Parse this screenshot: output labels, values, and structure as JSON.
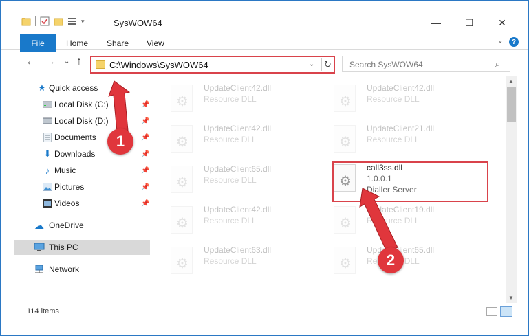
{
  "window": {
    "title": "SysWOW64",
    "controls": {
      "minimize": "—",
      "maximize": "☐",
      "close": "✕"
    }
  },
  "ribbon": {
    "file": "File",
    "tabs": [
      "Home",
      "Share",
      "View"
    ],
    "help": "?"
  },
  "address": {
    "path": "C:\\Windows\\SysWOW64",
    "search_placeholder": "Search SysWOW64"
  },
  "nav": {
    "quick_access": "Quick access",
    "items": [
      {
        "label": "Local Disk (C:)",
        "icon": "drive-icon",
        "pinned": true
      },
      {
        "label": "Local Disk (D:)",
        "icon": "drive-icon",
        "pinned": true
      },
      {
        "label": "Documents",
        "icon": "documents-icon",
        "pinned": true
      },
      {
        "label": "Downloads",
        "icon": "downloads-icon",
        "pinned": true
      },
      {
        "label": "Music",
        "icon": "music-icon",
        "pinned": true
      },
      {
        "label": "Pictures",
        "icon": "pictures-icon",
        "pinned": true
      },
      {
        "label": "Videos",
        "icon": "videos-icon",
        "pinned": true
      }
    ],
    "onedrive": "OneDrive",
    "this_pc": "This PC",
    "network": "Network"
  },
  "files": [
    {
      "name": "UpdateClient42.dll",
      "type": "Resource DLL"
    },
    {
      "name": "UpdateClient42.dll",
      "type": "Resource DLL"
    },
    {
      "name": "UpdateClient42.dll",
      "type": "Resource DLL"
    },
    {
      "name": "UpdateClient21.dll",
      "type": "Resource DLL"
    },
    {
      "name": "UpdateClient65.dll",
      "type": "Resource DLL"
    },
    {
      "name": "call3ss.dll",
      "version": "1.0.0.1",
      "description": "Dialler Server"
    },
    {
      "name": "UpdateClient42.dll",
      "type": "Resource DLL"
    },
    {
      "name": "UpdateClient19.dll",
      "type": "Resource DLL"
    },
    {
      "name": "UpdateClient63.dll",
      "type": "Resource DLL"
    },
    {
      "name": "UpdateClient65.dll",
      "type": "Resource DLL"
    }
  ],
  "status": {
    "count": "114 items"
  },
  "annotations": {
    "badge1": "1",
    "badge2": "2"
  },
  "colors": {
    "accent": "#1979ca",
    "highlight": "#d9434b",
    "badge": "#e0363c"
  }
}
